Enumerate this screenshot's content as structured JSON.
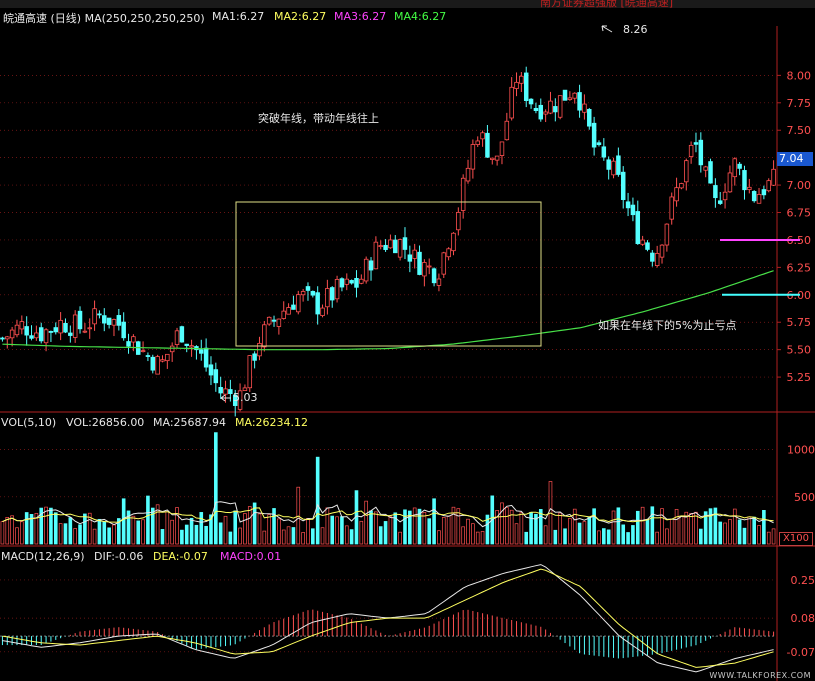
{
  "colors": {
    "background": "#000000",
    "up": "#ff5050",
    "down": "#54ffff",
    "ma250": "#48e048",
    "price_tag_bg": "#1a58d0",
    "box": "#e0e088",
    "support_line": "#ff44ff",
    "stop_line": "#44ffff",
    "header_main": "#e8e8e8",
    "ma1": "#e8e8e8",
    "ma2": "#ffff60",
    "ma3": "#ff44ff",
    "ma4": "#44ff44"
  },
  "header": {
    "stock": "皖通高速 (日线) MA(250,250,250,250)",
    "ma1": "MA1:6.27",
    "ma2": "MA2:6.27",
    "ma3": "MA3:6.27",
    "ma4": "MA4:6.27",
    "top_text": "南方证券超强版  [皖通高速]"
  },
  "annotations": {
    "breakout": "突破年线，带动年线往上",
    "stop_loss": "如果在年线下的5%为止亏点",
    "high": "8.26",
    "low": "5.03",
    "current_price": "7.04"
  },
  "volume_panel": {
    "title": "VOL(5,10)",
    "vol": "VOL:26856.00",
    "ma": "MA:25687.94",
    "ma2": "MA:26234.12",
    "unit": "X100"
  },
  "macd_panel": {
    "title": "MACD(12,26,9)",
    "dif": "DIF:-0.06",
    "dea": "DEA:-0.07",
    "macd": "MACD:0.01"
  },
  "watermark": "WWW.TALKFOREX.COM",
  "chart_data": [
    {
      "type": "candlestick",
      "title": "皖通高速 (日线)",
      "y_ticks": [
        "8.00",
        "7.75",
        "7.50",
        "7.25",
        "7.00",
        "6.75",
        "6.50",
        "6.25",
        "6.00",
        "5.75",
        "5.50",
        "5.25"
      ],
      "ylim": [
        4.95,
        8.45
      ],
      "high": 8.26,
      "low": 5.03,
      "last": 7.04,
      "support_level": 6.5,
      "stop_level": 6.0,
      "series": [
        {
          "name": "MA1",
          "values": [
            5.55,
            5.53,
            5.52,
            5.51,
            5.5,
            5.5,
            5.51,
            5.55,
            5.62,
            5.7,
            5.85,
            6.02,
            6.22
          ]
        }
      ],
      "close_path": [
        5.6,
        5.72,
        5.65,
        5.75,
        5.7,
        5.82,
        5.72,
        5.5,
        5.35,
        5.68,
        5.45,
        5.12,
        5.08,
        5.6,
        5.82,
        6.0,
        5.9,
        6.05,
        6.1,
        6.45,
        6.5,
        6.3,
        6.2,
        6.75,
        7.5,
        7.2,
        7.98,
        7.7,
        7.75,
        7.9,
        7.3,
        7.1,
        6.6,
        6.35,
        6.9,
        7.4,
        6.8,
        7.2,
        6.9,
        7.04
      ]
    },
    {
      "type": "bar",
      "title": "VOL(5,10)",
      "y_ticks": [
        "1000",
        "500"
      ],
      "ylim": [
        0,
        1250
      ],
      "unit": "X100"
    },
    {
      "type": "bar",
      "title": "MACD(12,26,9)",
      "y_ticks": [
        "0.25",
        "0.08",
        "-0.07"
      ],
      "ylim": [
        -0.2,
        0.33
      ],
      "dif_path": [
        -0.02,
        -0.05,
        -0.03,
        0.0,
        0.01,
        -0.06,
        -0.1,
        -0.04,
        0.06,
        0.1,
        0.08,
        0.1,
        0.22,
        0.28,
        0.32,
        0.18,
        0.0,
        -0.12,
        -0.16,
        -0.1,
        -0.06
      ],
      "dea_path": [
        0.0,
        -0.03,
        -0.04,
        -0.02,
        0.0,
        -0.03,
        -0.08,
        -0.07,
        0.0,
        0.06,
        0.08,
        0.08,
        0.16,
        0.24,
        0.3,
        0.22,
        0.05,
        -0.08,
        -0.14,
        -0.12,
        -0.07
      ]
    }
  ]
}
